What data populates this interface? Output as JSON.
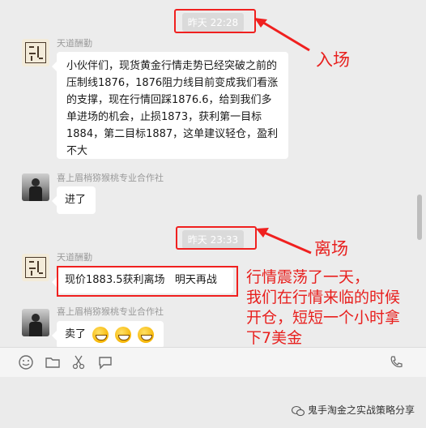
{
  "messages": {
    "ts1": "昨天 22:28",
    "sender1": "天道酬勤",
    "msg1": "小伙伴们，现货黄金行情走势已经突破之前的压制线1876，1876阻力线目前变成我们看涨的支撑，现在行情回踩1876.6，给到我们多单进场的机会，止损1873，获利第一目标1884，第二目标1887，这单建议轻仓，盈利不大",
    "sender2": "喜上眉梢猕猴桃专业合作社",
    "msg2": "进了",
    "ts2": "昨天 23:33",
    "sender3": "天道酬勤",
    "msg3": "现价1883.5获利离场   明天再战",
    "sender4": "喜上眉梢猕猴桃专业合作社",
    "msg4": "卖了"
  },
  "annotations": {
    "entry": "入场",
    "exit": "离场",
    "note_line1": "行情震荡了一天，",
    "note_line2": "我们在行情来临的时候",
    "note_line3": "开仓，短短一个小时拿",
    "note_line4": "下7美金"
  },
  "watermark": "鬼手淘金之实战策略分享",
  "icons": [
    "emoji-icon",
    "folder-icon",
    "scissors-icon",
    "chat-bubble-icon",
    "video-call-icon"
  ],
  "colors": {
    "annotation_red": "#f0201f",
    "bubble": "#ffffff",
    "background": "#ececec"
  }
}
